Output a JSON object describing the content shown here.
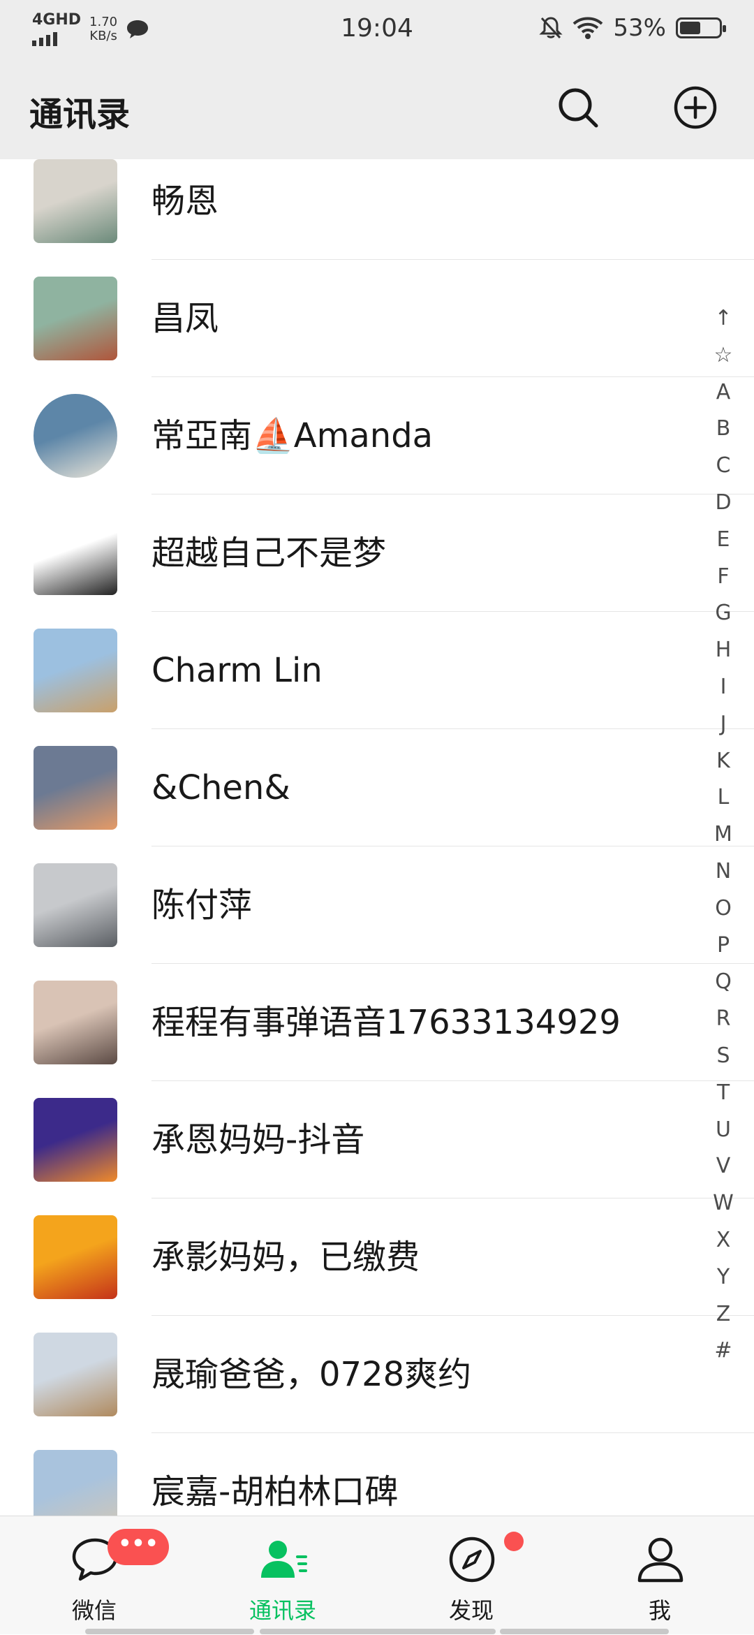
{
  "status_bar": {
    "network": "4GHD",
    "speed_value": "1.70",
    "speed_unit": "KB/s",
    "time": "19:04",
    "battery_percent": "53%",
    "battery_level": 0.53
  },
  "header": {
    "title": "通讯录",
    "search_icon": "search-icon",
    "add_icon": "add-circle-icon"
  },
  "contacts": [
    {
      "name": "畅恩",
      "avatar_colors": [
        "#d8d4cc",
        "#6b8a7a"
      ]
    },
    {
      "name": "昌凤",
      "avatar_colors": [
        "#8fb3a0",
        "#b0553a"
      ]
    },
    {
      "name": "常亞南⛵Amanda",
      "avatar_colors": [
        "#5d86a8",
        "#e9e4d8"
      ]
    },
    {
      "name": "超越自己不是梦",
      "avatar_colors": [
        "#ffffff",
        "#222222"
      ]
    },
    {
      "name": "Charm Lin",
      "avatar_colors": [
        "#9cc0e0",
        "#c9a06a"
      ]
    },
    {
      "name": "&Chen&",
      "avatar_colors": [
        "#6c7a93",
        "#e59a66"
      ]
    },
    {
      "name": "陈付萍",
      "avatar_colors": [
        "#c7c9cc",
        "#5a5e63"
      ]
    },
    {
      "name": "程程有事弹语音17633134929",
      "avatar_colors": [
        "#d9c3b5",
        "#5b4a44"
      ]
    },
    {
      "name": "承恩妈妈-抖音",
      "avatar_colors": [
        "#3c2a8a",
        "#f08a2a"
      ]
    },
    {
      "name": "承影妈妈，已缴费",
      "avatar_colors": [
        "#f4a41c",
        "#c4321a"
      ]
    },
    {
      "name": "晟瑜爸爸，0728爽约",
      "avatar_colors": [
        "#cfd8e2",
        "#b08a5e"
      ]
    },
    {
      "name": "宸嘉-胡柏林口碑",
      "avatar_colors": [
        "#a9c3dd",
        "#d3c7b5"
      ]
    }
  ],
  "index_letters": [
    "↑",
    "☆",
    "A",
    "B",
    "C",
    "D",
    "E",
    "F",
    "G",
    "H",
    "I",
    "J",
    "K",
    "L",
    "M",
    "N",
    "O",
    "P",
    "Q",
    "R",
    "S",
    "T",
    "U",
    "V",
    "W",
    "X",
    "Y",
    "Z",
    "#"
  ],
  "tabs": [
    {
      "label": "微信",
      "icon": "chat-bubble-icon",
      "badge": "•••",
      "active": false
    },
    {
      "label": "通讯录",
      "icon": "contacts-icon",
      "active": true
    },
    {
      "label": "发现",
      "icon": "compass-icon",
      "badge_dot": true,
      "active": false
    },
    {
      "label": "我",
      "icon": "person-icon",
      "active": false
    }
  ],
  "colors": {
    "accent": "#07c160",
    "badge": "#fa5151",
    "header_bg": "#ededed"
  }
}
